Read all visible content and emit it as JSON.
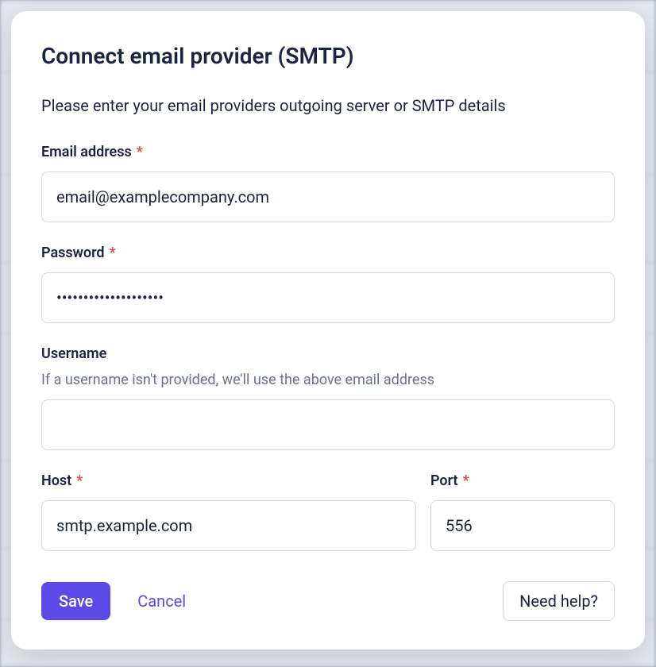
{
  "modal": {
    "title": "Connect email provider (SMTP)",
    "subtitle": "Please enter your email providers outgoing server or SMTP details"
  },
  "fields": {
    "email": {
      "label": "Email address",
      "value": "email@examplecompany.com",
      "required": "*"
    },
    "password": {
      "label": "Password",
      "value": "••••••••••••••••••••",
      "required": "*"
    },
    "username": {
      "label": "Username",
      "help": "If a username isn't provided, we'll use the above email address",
      "value": ""
    },
    "host": {
      "label": "Host",
      "value": "smtp.example.com",
      "required": "*"
    },
    "port": {
      "label": "Port",
      "value": "556",
      "required": "*"
    }
  },
  "buttons": {
    "save": "Save",
    "cancel": "Cancel",
    "help": "Need help?"
  }
}
